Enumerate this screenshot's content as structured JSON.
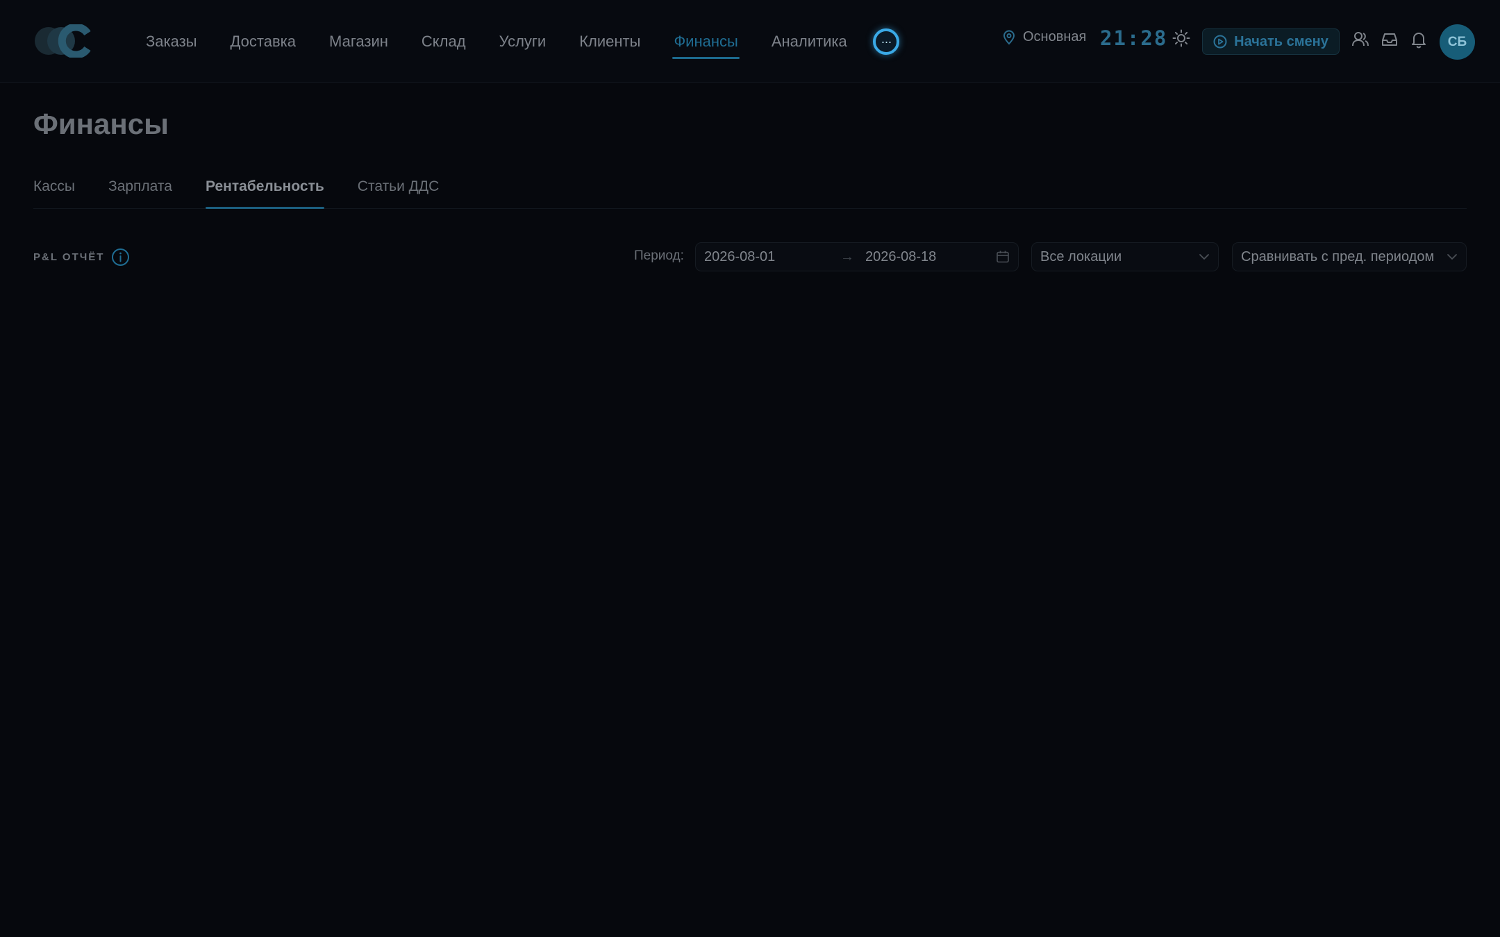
{
  "header": {
    "nav": [
      {
        "label": "Заказы"
      },
      {
        "label": "Доставка"
      },
      {
        "label": "Магазин"
      },
      {
        "label": "Склад"
      },
      {
        "label": "Услуги"
      },
      {
        "label": "Клиенты"
      },
      {
        "label": "Финансы",
        "active": true
      },
      {
        "label": "Аналитика"
      }
    ],
    "more_glyph": "···",
    "location": "Основная",
    "clock": "21:28",
    "shift_button": "Начать смену",
    "avatar_initials": "СБ",
    "accent_color": "#1f6d93",
    "highlight_color": "#3aa9e6"
  },
  "page": {
    "title": "Финансы",
    "tabs": [
      {
        "label": "Кассы"
      },
      {
        "label": "Зарплата"
      },
      {
        "label": "Рентабельность",
        "active": true
      },
      {
        "label": "Статьи ДДС"
      }
    ]
  },
  "report": {
    "title": "P&L ОТЧЁТ",
    "period_label": "Период:",
    "date_from": "2026-08-01",
    "date_to": "2026-08-18",
    "range_arrow": "→",
    "location_filter": "Все локации",
    "compare_filter": "Сравнивать с пред. периодом"
  }
}
